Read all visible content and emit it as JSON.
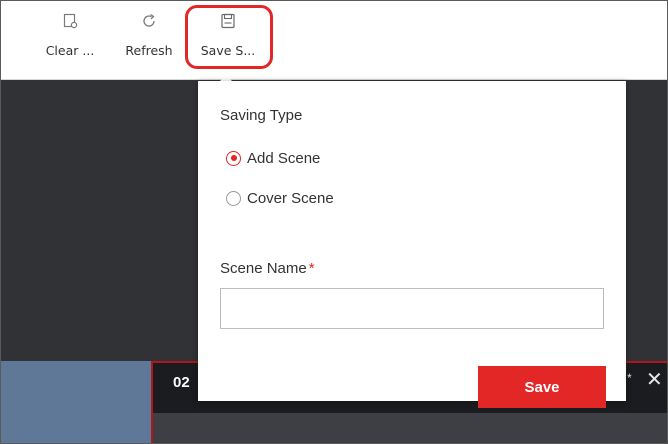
{
  "toolbar": {
    "clear_label": "Clear ...",
    "refresh_label": "Refresh",
    "save_label": "Save S..."
  },
  "video": {
    "window_id": "02",
    "star": "*",
    "close": "✕"
  },
  "popup": {
    "saving_type_label": "Saving Type",
    "options": [
      {
        "label": "Add Scene",
        "checked": true
      },
      {
        "label": "Cover Scene",
        "checked": false
      }
    ],
    "scene_name_label": "Scene Name",
    "required_mark": "*",
    "scene_name_value": "",
    "save_button": "Save"
  },
  "colors": {
    "accent": "#e32626",
    "side_panel": "#5f7898",
    "background": "#303236"
  },
  "icons": {
    "clear": "clear-icon",
    "refresh": "refresh-icon",
    "save": "save-icon"
  }
}
